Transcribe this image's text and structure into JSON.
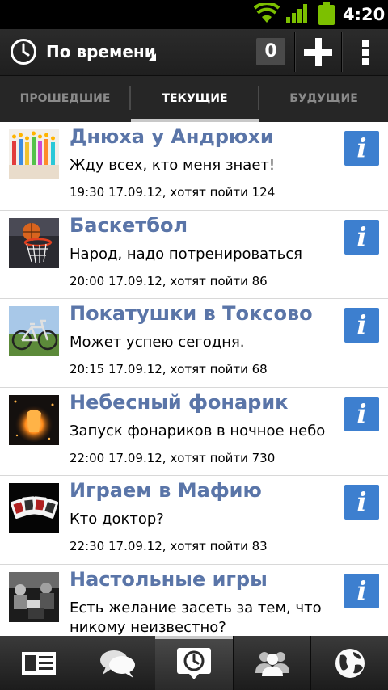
{
  "status_bar": {
    "time": "4:20"
  },
  "action_bar": {
    "sort_label": "По времени",
    "counter": "0"
  },
  "tabs": [
    {
      "label": "ПРОШЕДШИЕ",
      "active": false
    },
    {
      "label": "ТЕКУЩИЕ",
      "active": true
    },
    {
      "label": "БУДУЩИЕ",
      "active": false
    }
  ],
  "events": [
    {
      "title": "Днюха у Андрюхи",
      "description": "Жду всех, кто меня знает!",
      "meta": "19:30 17.09.12, хотят пойти 124",
      "thumb": "birthday-candles"
    },
    {
      "title": "Баскетбол",
      "description": "Народ, надо потренироваться",
      "meta": "20:00 17.09.12, хотят пойти 86",
      "thumb": "basketball-hoop"
    },
    {
      "title": "Покатушки в Токсово",
      "description": "Может успею сегодня.",
      "meta": "20:15 17.09.12, хотят пойти 68",
      "thumb": "bicycle"
    },
    {
      "title": "Небесный фонарик",
      "description": "Запуск фонариков в ночное небо",
      "meta": "22:00 17.09.12, хотят пойти 730",
      "thumb": "sky-lantern"
    },
    {
      "title": "Играем в Мафию",
      "description": "Кто доктор?",
      "meta": "22:30 17.09.12, хотят пойти 83",
      "thumb": "playing-cards"
    },
    {
      "title": "Настольные игры",
      "description": "Есть желание засеть за тем, что никому неизвестно?",
      "meta": "",
      "thumb": "board-game-people"
    }
  ],
  "info_glyph": "i",
  "bottom_nav": [
    {
      "icon": "news-feed-icon",
      "active": false
    },
    {
      "icon": "messages-icon",
      "active": false
    },
    {
      "icon": "events-clock-icon",
      "active": true
    },
    {
      "icon": "friends-icon",
      "active": false
    },
    {
      "icon": "globe-icon",
      "active": false
    }
  ],
  "colors": {
    "title_blue": "#5a75a8",
    "info_blue": "#3d7fcf",
    "status_bar_bg": "#000000",
    "action_bar_bg": "#262626"
  }
}
